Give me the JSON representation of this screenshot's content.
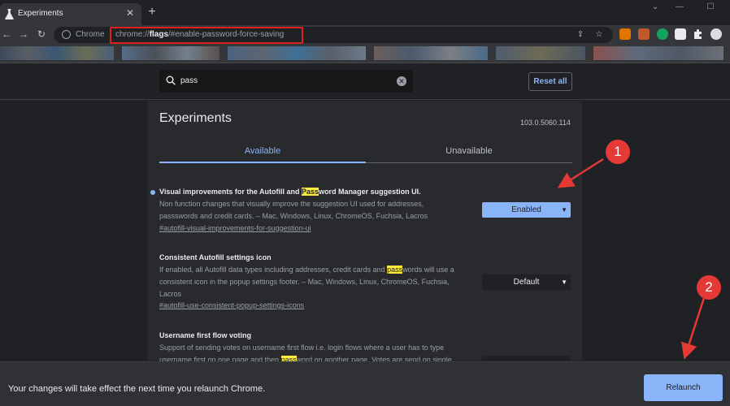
{
  "tab": {
    "title": "Experiments",
    "close": "✕",
    "new": "+"
  },
  "window_controls": {
    "minimize": "—",
    "maximize": "☐",
    "menu": "⌄"
  },
  "toolbar": {
    "back": "←",
    "forward": "→",
    "reload": "↻",
    "site_label": "Chrome",
    "url_prefix": "chrome://",
    "url_bold": "flags",
    "url_suffix": "/#enable-password-force-saving",
    "share": "⇪",
    "star": "☆"
  },
  "search": {
    "value": "pass",
    "clear": "✕"
  },
  "reset_all_label": "Reset all",
  "page": {
    "title": "Experiments",
    "version": "103.0.5060.114",
    "tabs": [
      "Available",
      "Unavailable"
    ]
  },
  "experiments": [
    {
      "name_before": "Visual improvements for the Autofill and ",
      "name_hl": "Pass",
      "name_after": "word Manager suggestion UI.",
      "desc": "Non function changes that visually improve the suggestion UI used for addresses, passswords and credit cards. – Mac, Windows, Linux, ChromeOS, Fuchsia, Lacros",
      "link": "#autofill-visual-improvements-for-suggestion-ui",
      "select": "Enabled"
    },
    {
      "name": "Consistent Autofill settings icon",
      "desc_before": "If enabled, all Autofill data types including addresses, credit cards and ",
      "desc_hl": "pass",
      "desc_after": "words will use a consistent icon in the popup settings footer. – Mac, Windows, Linux, ChromeOS, Fuchsia, Lacros",
      "link": "#autofill-use-consistent-popup-settings-icons",
      "select": "Default"
    },
    {
      "name": "Username first flow voting",
      "desc_before": "Support of sending votes on username first flow i.e. login flows where a user has to type username first on one page and then ",
      "desc_hl": "pass",
      "desc_after": "word on another page. Votes are send on single"
    }
  ],
  "annotations": [
    "1",
    "2"
  ],
  "relaunch": {
    "message": "Your changes will take effect the next time you relaunch Chrome.",
    "button": "Relaunch"
  },
  "colors": {
    "accent": "#8ab4f8",
    "highlight": "#ffeb3b",
    "annotation_red": "#e53935",
    "url_box_red": "#e02020"
  }
}
